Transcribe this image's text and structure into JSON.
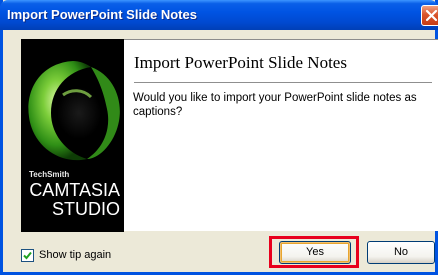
{
  "window": {
    "title": "Import PowerPoint Slide Notes"
  },
  "dialog": {
    "heading": "Import PowerPoint Slide Notes",
    "message": "Would you like to import your PowerPoint slide notes as captions?"
  },
  "branding": {
    "company": "TechSmith",
    "product_line1": "CAMTASIA",
    "product_line2": "STUDIO"
  },
  "footer": {
    "checkbox_label": "Show tip again",
    "checkbox_checked": true,
    "yes_label": "Yes",
    "no_label": "No"
  },
  "colors": {
    "titlebar": "#0054e3",
    "highlight": "#e8001c",
    "logo_green": "#58b82a"
  }
}
